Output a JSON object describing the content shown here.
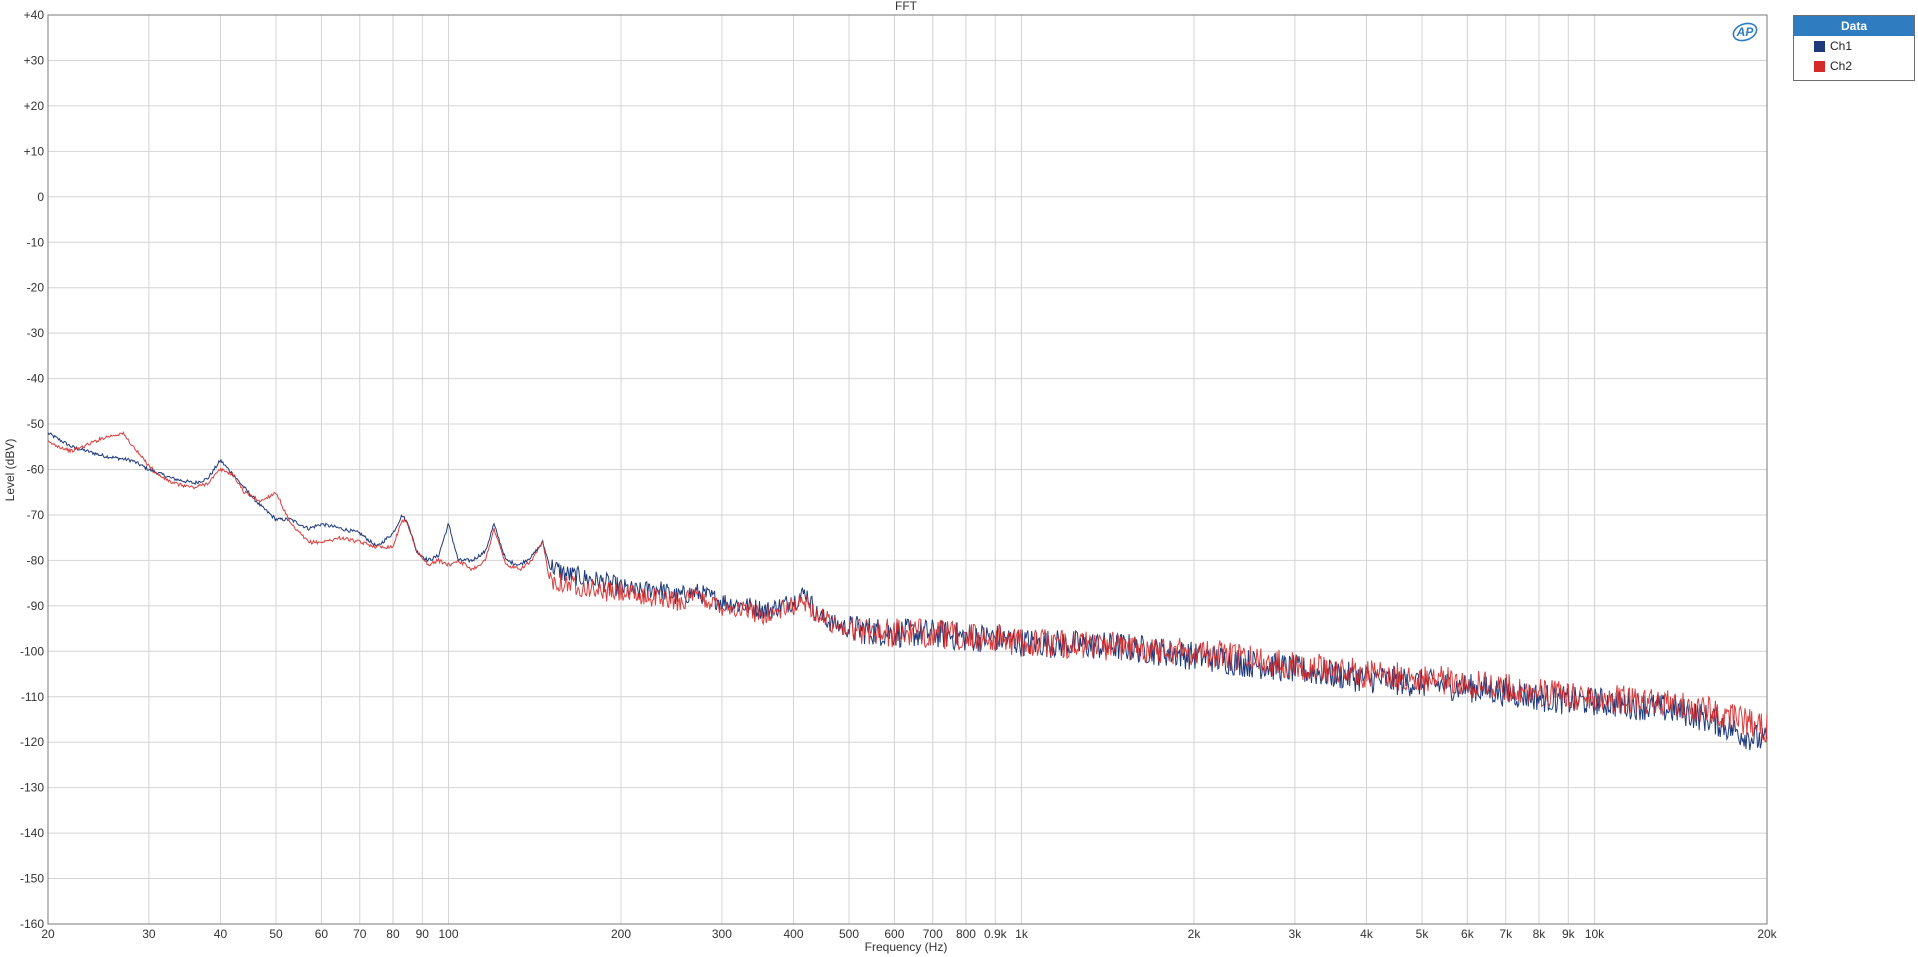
{
  "chart_data": {
    "type": "line",
    "title": "FFT",
    "xlabel": "Frequency (Hz)",
    "ylabel": "Level (dBV)",
    "xscale": "log",
    "xlim": [
      20,
      20000
    ],
    "ylim": [
      -160,
      40
    ],
    "grid": true,
    "legend_position": "right-top",
    "legend_title": "Data",
    "x_ticks": [
      {
        "value": 20,
        "label": "20"
      },
      {
        "value": 30,
        "label": "30"
      },
      {
        "value": 40,
        "label": "40"
      },
      {
        "value": 50,
        "label": "50"
      },
      {
        "value": 60,
        "label": "60"
      },
      {
        "value": 70,
        "label": "70"
      },
      {
        "value": 80,
        "label": "80"
      },
      {
        "value": 90,
        "label": "90"
      },
      {
        "value": 100,
        "label": "100"
      },
      {
        "value": 200,
        "label": "200"
      },
      {
        "value": 300,
        "label": "300"
      },
      {
        "value": 400,
        "label": "400"
      },
      {
        "value": 500,
        "label": "500"
      },
      {
        "value": 600,
        "label": "600"
      },
      {
        "value": 700,
        "label": "700"
      },
      {
        "value": 800,
        "label": "800"
      },
      {
        "value": 900,
        "label": "0.9k"
      },
      {
        "value": 1000,
        "label": "1k"
      },
      {
        "value": 2000,
        "label": "2k"
      },
      {
        "value": 3000,
        "label": "3k"
      },
      {
        "value": 4000,
        "label": "4k"
      },
      {
        "value": 5000,
        "label": "5k"
      },
      {
        "value": 6000,
        "label": "6k"
      },
      {
        "value": 7000,
        "label": "7k"
      },
      {
        "value": 8000,
        "label": "8k"
      },
      {
        "value": 9000,
        "label": "9k"
      },
      {
        "value": 10000,
        "label": "10k"
      },
      {
        "value": 20000,
        "label": "20k"
      }
    ],
    "y_ticks": [
      {
        "value": 40,
        "label": "+40"
      },
      {
        "value": 30,
        "label": "+30"
      },
      {
        "value": 20,
        "label": "+20"
      },
      {
        "value": 10,
        "label": "+10"
      },
      {
        "value": 0,
        "label": "0"
      },
      {
        "value": -10,
        "label": "-10"
      },
      {
        "value": -20,
        "label": "-20"
      },
      {
        "value": -30,
        "label": "-30"
      },
      {
        "value": -40,
        "label": "-40"
      },
      {
        "value": -50,
        "label": "-50"
      },
      {
        "value": -60,
        "label": "-60"
      },
      {
        "value": -70,
        "label": "-70"
      },
      {
        "value": -80,
        "label": "-80"
      },
      {
        "value": -90,
        "label": "-90"
      },
      {
        "value": -100,
        "label": "-100"
      },
      {
        "value": -110,
        "label": "-110"
      },
      {
        "value": -120,
        "label": "-120"
      },
      {
        "value": -130,
        "label": "-130"
      },
      {
        "value": -140,
        "label": "-140"
      },
      {
        "value": -150,
        "label": "-150"
      },
      {
        "value": -160,
        "label": "-160"
      }
    ],
    "series": [
      {
        "name": "Ch1",
        "color": "#1f3a7a",
        "x": [
          20,
          22,
          25,
          28,
          30,
          33,
          36,
          38,
          40,
          42,
          44,
          47,
          50,
          53,
          57,
          60,
          65,
          70,
          75,
          80,
          83,
          85,
          88,
          92,
          96,
          100,
          104,
          110,
          116,
          120,
          126,
          133,
          140,
          146,
          150,
          160,
          175,
          190,
          200,
          215,
          230,
          250,
          270,
          300,
          330,
          360,
          400,
          420,
          440,
          470,
          500,
          600,
          700,
          800,
          900,
          1000,
          1500,
          2000,
          3000,
          4000,
          5000,
          6000,
          7000,
          8000,
          9000,
          10000,
          12000,
          14000,
          16000,
          18000,
          20000
        ],
        "values": [
          -52,
          -55,
          -57,
          -58,
          -60,
          -62,
          -63,
          -62,
          -58,
          -61,
          -64,
          -68,
          -71,
          -71,
          -73,
          -72,
          -73,
          -74,
          -77,
          -74,
          -70,
          -72,
          -78,
          -80,
          -79,
          -72,
          -80,
          -80,
          -78,
          -72,
          -80,
          -81,
          -79,
          -76,
          -81,
          -83,
          -84,
          -85,
          -86,
          -87,
          -86,
          -88,
          -87,
          -89,
          -90,
          -91,
          -89,
          -87,
          -92,
          -94,
          -95,
          -96,
          -96,
          -97,
          -97,
          -98,
          -99,
          -101,
          -104,
          -106,
          -107,
          -108,
          -109,
          -110,
          -111,
          -111,
          -112,
          -113,
          -115,
          -118,
          -120
        ]
      },
      {
        "name": "Ch2",
        "color": "#d42a2a",
        "x": [
          20,
          22,
          25,
          27,
          29,
          31,
          33,
          36,
          38,
          40,
          42,
          44,
          47,
          50,
          53,
          57,
          60,
          65,
          70,
          75,
          80,
          83,
          85,
          88,
          92,
          96,
          100,
          104,
          110,
          116,
          120,
          126,
          133,
          140,
          146,
          150,
          160,
          175,
          190,
          200,
          215,
          230,
          250,
          270,
          300,
          330,
          360,
          400,
          420,
          440,
          470,
          500,
          600,
          700,
          800,
          900,
          1000,
          1500,
          2000,
          3000,
          4000,
          5000,
          6000,
          7000,
          8000,
          9000,
          10000,
          12000,
          14000,
          16000,
          18000,
          20000
        ],
        "values": [
          -54,
          -56,
          -53,
          -52,
          -57,
          -61,
          -63,
          -64,
          -63,
          -60,
          -61,
          -65,
          -67,
          -65,
          -72,
          -76,
          -76,
          -75,
          -76,
          -77,
          -77,
          -71,
          -72,
          -78,
          -81,
          -80,
          -81,
          -80,
          -82,
          -80,
          -73,
          -81,
          -82,
          -80,
          -76,
          -84,
          -85,
          -86,
          -87,
          -87,
          -88,
          -88,
          -89,
          -88,
          -90,
          -91,
          -92,
          -90,
          -89,
          -92,
          -94,
          -95,
          -96,
          -96,
          -97,
          -97,
          -98,
          -99,
          -100,
          -103,
          -105,
          -106,
          -107,
          -108,
          -109,
          -110,
          -110,
          -111,
          -112,
          -113,
          -115,
          -117
        ]
      }
    ]
  },
  "logo_text": "AP"
}
